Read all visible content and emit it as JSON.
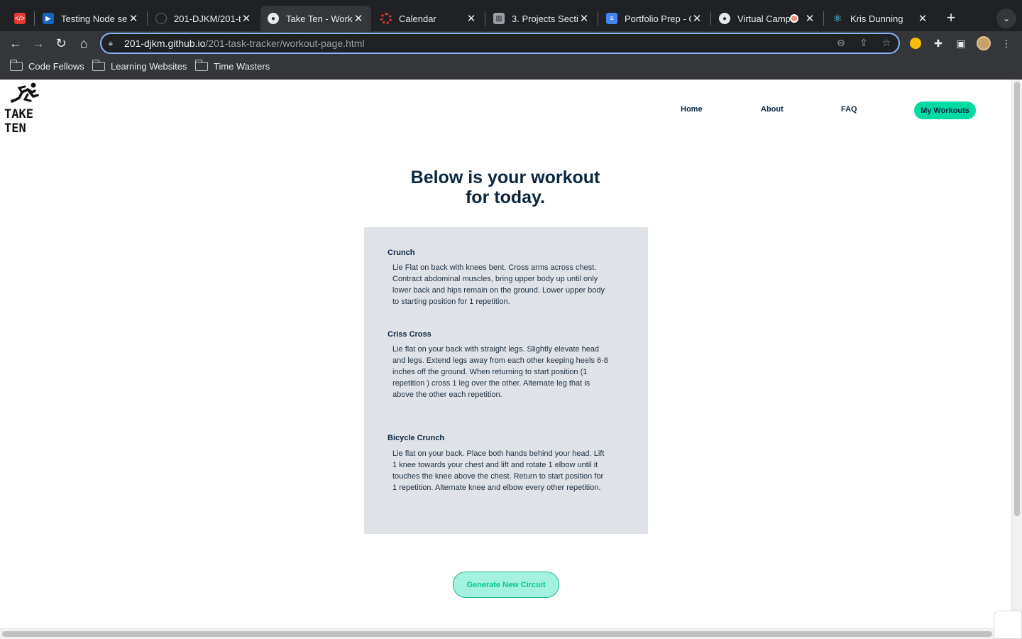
{
  "browser": {
    "tabs": [
      {
        "title": "",
        "icon": "shield-icon",
        "color": "#e53935"
      },
      {
        "title": "Testing Node ser",
        "icon": "video-icon",
        "color": "#1565c0"
      },
      {
        "title": "201-DJKM/201-t",
        "icon": "github-icon",
        "color": "#202124"
      },
      {
        "title": "Take Ten - Worko",
        "icon": "globe-icon",
        "color": "#e8eaed",
        "active": true
      },
      {
        "title": "Calendar",
        "icon": "calendar-icon",
        "color": "#e53935"
      },
      {
        "title": "3. Projects Secti",
        "icon": "trello-icon",
        "color": "#9aa0a6"
      },
      {
        "title": "Portfolio Prep - C",
        "icon": "doc-icon",
        "color": "#4285f4"
      },
      {
        "title": "Virtual Camp",
        "icon": "globe-icon",
        "color": "#e8eaed"
      },
      {
        "title": "Kris Dunning",
        "icon": "react-icon",
        "color": "#61dafb"
      }
    ],
    "url_host": "201-djkm.github.io",
    "url_path": "/201-task-tracker/workout-page.html",
    "bookmarks": [
      "Code Fellows",
      "Learning Websites",
      "Time Wasters"
    ]
  },
  "site": {
    "logo_text": "TAKE TEN",
    "nav": [
      "Home",
      "About",
      "FAQ"
    ],
    "nav_active": "My Workouts",
    "title_line1": "Below is your workout",
    "title_line2": "for today.",
    "exercises": [
      {
        "name": "Crunch",
        "description": "Lie Flat on back with knees bent. Cross arms across chest. Contract abdominal muscles, bring upper body up until only lower back and hips remain on the ground. Lower upper body to starting position for 1 repetition."
      },
      {
        "name": "Criss Cross",
        "description": "Lie flat on your back with straight legs. Slightly elevate head and legs. Extend legs away from each other keeping heels 6-8 inches off the ground. When returning to start position (1 repetition ) cross 1 leg over the other. Alternate leg that is above the other each repetition."
      },
      {
        "name": "Bicycle Crunch",
        "description": "Lie flat on your back. Place both hands behind your head. Lift 1 knee towards your chest and lift and rotate 1 elbow until it touches the knee above the chest. Return to start position for 1 repetition. Alternate knee and elbow every other repetition."
      }
    ],
    "generate_button": "Generate New Circuit"
  },
  "colors": {
    "navy": "#0b2740",
    "accent": "#00dba3",
    "card": "#dfe2e7"
  }
}
